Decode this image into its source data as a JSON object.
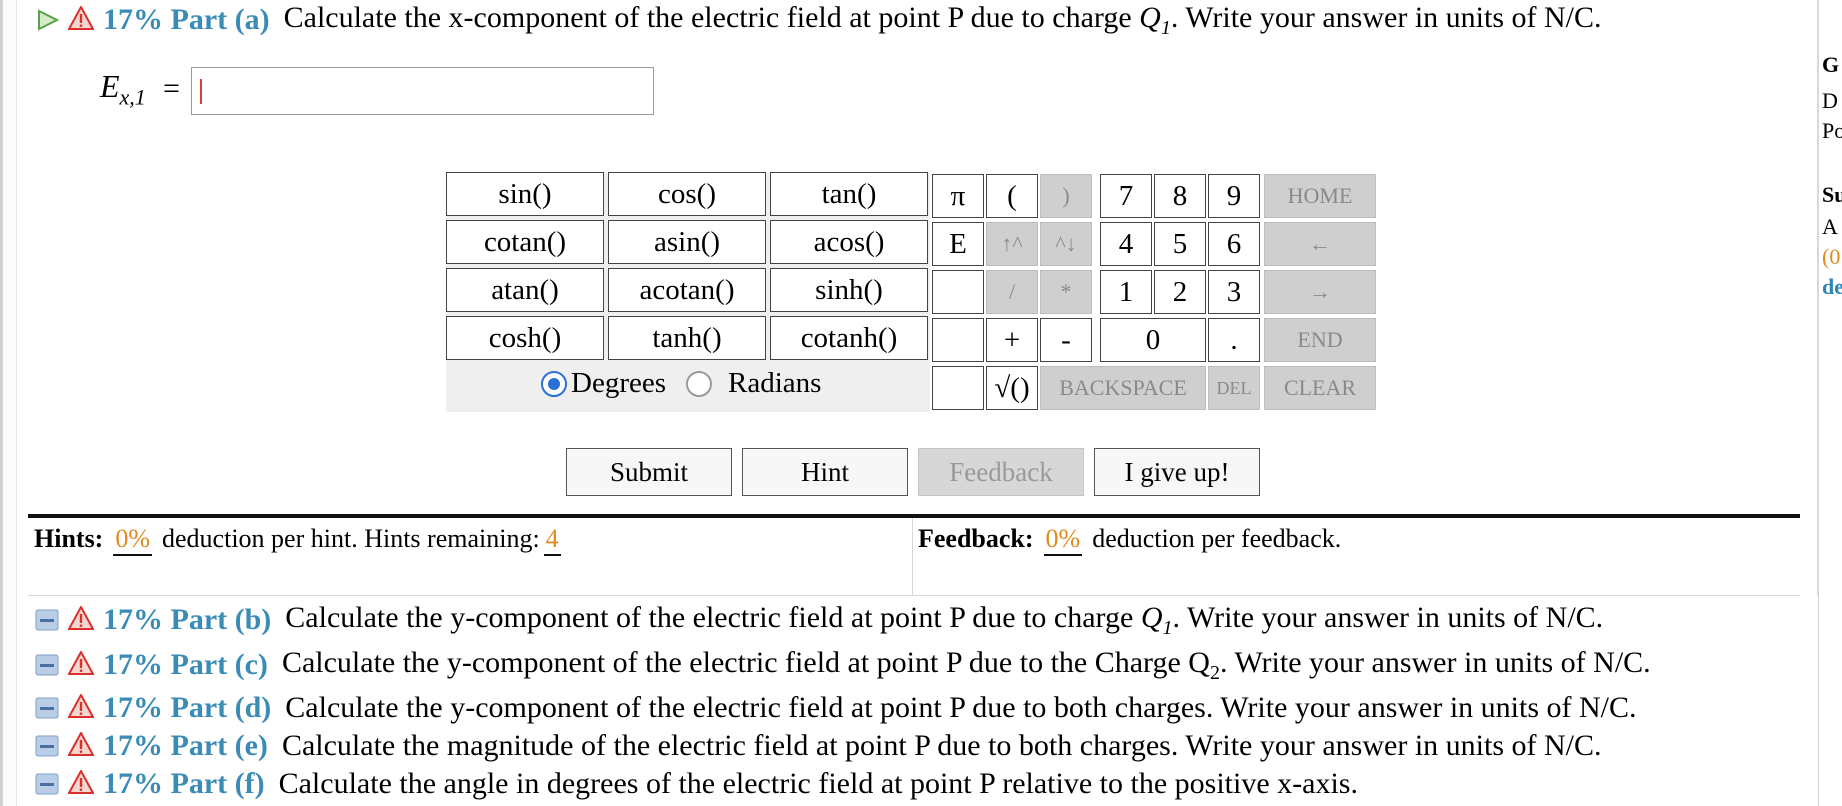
{
  "part_a": {
    "percent_label": "17% Part (a)",
    "question_prefix": "Calculate the x-component of the electric field at point P due to charge ",
    "question_var": "Q",
    "question_sub": "1",
    "question_suffix": ". Write your answer in units of N/C.",
    "answer_label_var": "E",
    "answer_label_sub": "x,1",
    "equals": "=",
    "answer_value": ""
  },
  "functions": [
    "sin()",
    "cos()",
    "tan()",
    "cotan()",
    "asin()",
    "acos()",
    "atan()",
    "acotan()",
    "sinh()",
    "cosh()",
    "tanh()",
    "cotanh()"
  ],
  "angle_mode": {
    "degrees": "Degrees",
    "radians": "Radians",
    "selected": "Degrees"
  },
  "keypad": {
    "pi": "π",
    "e": "E",
    "lparen": "(",
    "rparen": ")",
    "up": "↑^",
    "down": "^↓",
    "div": "/",
    "mul": "*",
    "plus": "+",
    "minus": "-",
    "sqrt": "√()",
    "dot": ".",
    "d7": "7",
    "d8": "8",
    "d9": "9",
    "d4": "4",
    "d5": "5",
    "d6": "6",
    "d1": "1",
    "d2": "2",
    "d3": "3",
    "d0": "0",
    "home": "HOME",
    "left": "←",
    "right": "→",
    "end": "END",
    "backspace": "BACKSPACE",
    "del": "DEL",
    "clear": "CLEAR"
  },
  "actions": {
    "submit": "Submit",
    "hint": "Hint",
    "feedback": "Feedback",
    "give_up": "I give up!"
  },
  "hints": {
    "label": "Hints:",
    "deduction": "0%",
    "text": "deduction per hint. Hints remaining:",
    "remaining": "4"
  },
  "feedback_info": {
    "label": "Feedback:",
    "deduction": "0%",
    "text": "deduction per feedback."
  },
  "other_parts": [
    {
      "percent_label": "17% Part (b)",
      "prefix": "Calculate the y-component of the electric field at point P due to charge ",
      "var": "Q",
      "sub": "1",
      "suffix": ". Write your answer in units of N/C."
    },
    {
      "percent_label": "17% Part (c)",
      "prefix": "Calculate the y-component of the electric field at point P due to the Charge Q",
      "var": "",
      "sub": "2",
      "suffix": ". Write your answer in units of N/C."
    },
    {
      "percent_label": "17% Part (d)",
      "prefix": "Calculate the y-component of the electric field at point P due to both charges. Write your answer in units of N/C.",
      "var": "",
      "sub": "",
      "suffix": ""
    },
    {
      "percent_label": "17% Part (e)",
      "prefix": "Calculate the magnitude of the electric field at point P due to both charges. Write your answer in units of N/C.",
      "var": "",
      "sub": "",
      "suffix": ""
    },
    {
      "percent_label": "17% Part (f)",
      "prefix": "Calculate the angle in degrees of the electric field at point P relative to the positive x-axis.",
      "var": "",
      "sub": "",
      "suffix": ""
    }
  ],
  "right_panel": {
    "line1": "G",
    "line2": "D",
    "line3": "Po",
    "line4": "Su",
    "line5": "A",
    "line6": "(0",
    "line7": "de"
  },
  "colors": {
    "accent_blue": "#3a8bb6",
    "orange": "#e08a1e",
    "warning_red": "#d9302c",
    "caret": "#e23a3a"
  },
  "icons": {
    "expand": "expand-triangle-icon",
    "collapse": "collapse-box-icon",
    "warning": "warning-icon"
  }
}
